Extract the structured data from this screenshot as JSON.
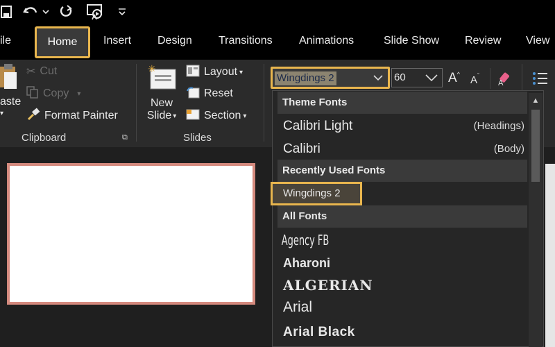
{
  "qat": {
    "save_icon": "save-icon",
    "undo_icon": "undo-icon",
    "redo_icon": "redo-icon",
    "present_icon": "present-from-start-icon",
    "customize_icon": "customize-qat-icon"
  },
  "tabs": {
    "file": "ile",
    "home": "Home",
    "insert": "Insert",
    "design": "Design",
    "transitions": "Transitions",
    "animations": "Animations",
    "slideshow": "Slide Show",
    "review": "Review",
    "view": "View"
  },
  "clipboard": {
    "paste": "aste",
    "cut": "Cut",
    "copy": "Copy",
    "format_painter": "Format Painter",
    "group_label": "Clipboard"
  },
  "slides": {
    "new_slide_line1": "New",
    "new_slide_line2": "Slide",
    "layout": "Layout",
    "reset": "Reset",
    "section": "Section",
    "group_label": "Slides"
  },
  "font": {
    "current_font": "Wingdings 2",
    "current_size": "60",
    "grow_label": "A",
    "shrink_label": "A"
  },
  "dropdown": {
    "theme_header": "Theme Fonts",
    "theme_fonts": [
      {
        "name": "Calibri Light",
        "tag": "(Headings)"
      },
      {
        "name": "Calibri",
        "tag": "(Body)"
      }
    ],
    "recent_header": "Recently Used Fonts",
    "recent_font": "Wingdings 2",
    "all_header": "All Fonts",
    "all_fonts": [
      "Agency FB",
      "Aharoni",
      "ALGERIAN",
      "Arial",
      "Arial Black"
    ]
  },
  "colors": {
    "highlight": "#e9b64e",
    "slide_border": "#d58a7e"
  }
}
